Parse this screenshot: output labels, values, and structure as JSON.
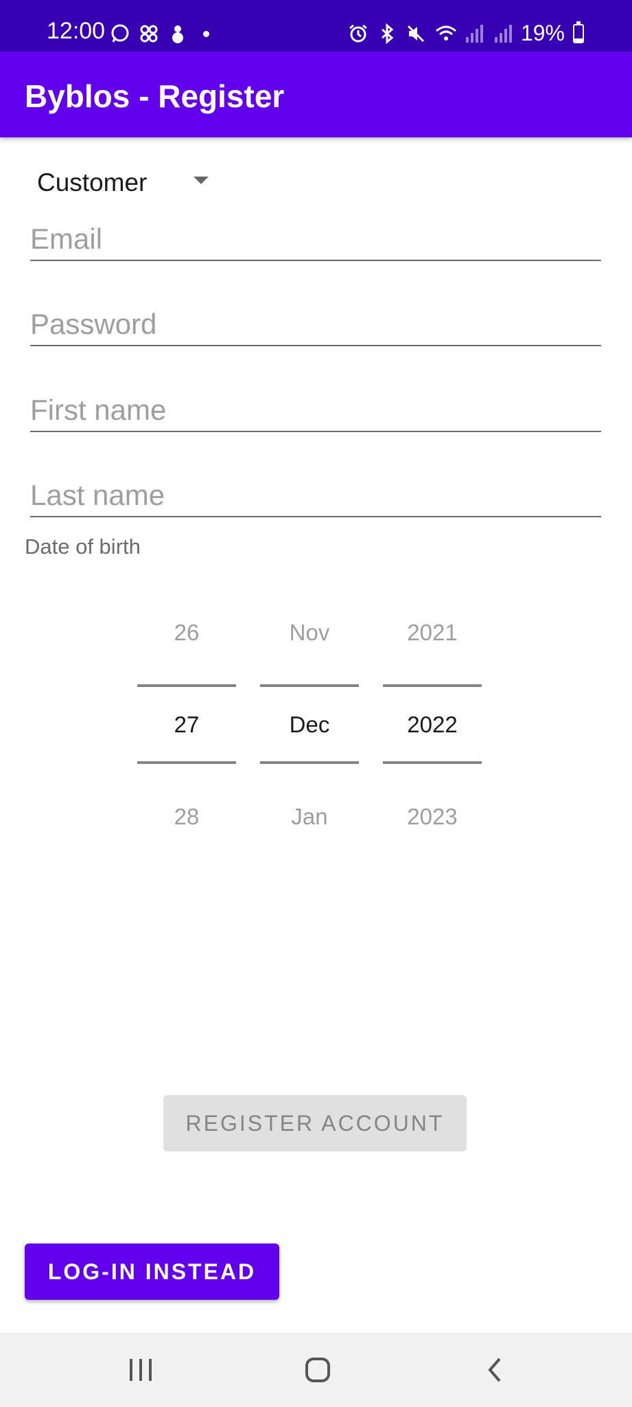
{
  "status_bar": {
    "time": "12:00",
    "battery": "19%",
    "battery_level": 0.19,
    "left_icons": [
      "whatsapp-icon",
      "pinwheel-icon",
      "snowman-icon",
      "notification-dot-icon"
    ],
    "right_icons": [
      "alarm-icon",
      "bluetooth-icon",
      "mute-icon",
      "wifi-icon",
      "signal-icon",
      "signal-icon",
      "battery-icon"
    ]
  },
  "app_bar": {
    "title": "Byblos - Register"
  },
  "role_spinner": {
    "value": "Customer"
  },
  "fields": {
    "email": {
      "placeholder": "Email",
      "value": ""
    },
    "password": {
      "placeholder": "Password",
      "value": ""
    },
    "first_name": {
      "placeholder": "First name",
      "value": ""
    },
    "last_name": {
      "placeholder": "Last name",
      "value": ""
    }
  },
  "dob_label": "Date of birth",
  "date_picker": {
    "day": {
      "prev": "26",
      "current": "27",
      "next": "28"
    },
    "month": {
      "prev": "Nov",
      "current": "Dec",
      "next": "Jan"
    },
    "year": {
      "prev": "2021",
      "current": "2022",
      "next": "2023"
    }
  },
  "buttons": {
    "register": "REGISTER ACCOUNT",
    "login": "LOG-IN INSTEAD"
  },
  "colors": {
    "status_bar": "#3700b3",
    "primary": "#6200ee",
    "disabled_button": "#e0e0e0"
  },
  "nav_bar": {
    "icons": [
      "recents-icon",
      "home-icon",
      "back-icon"
    ]
  }
}
